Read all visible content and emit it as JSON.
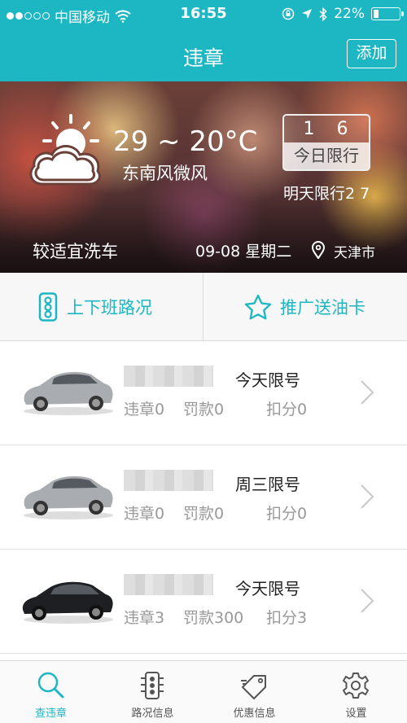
{
  "status_bar": {
    "carrier": "中国移动",
    "time": "16:55",
    "battery": "22%",
    "battery_fraction": 0.22
  },
  "nav": {
    "title": "违章",
    "add_label": "添加"
  },
  "weather": {
    "temp": "29 ~ 20°C",
    "wind": "东南风微风",
    "today_limit_number": "1 6",
    "today_limit_label": "今日限行",
    "tomorrow_limit": "明天限行2 7",
    "wash_advice": "较适宜洗车",
    "date": "09-08 星期二",
    "city": "天津市"
  },
  "quick_actions": {
    "commute_label": "上下班路况",
    "promo_label": "推广送油卡"
  },
  "vehicles": [
    {
      "status": "今天限号",
      "violations": "违章0",
      "fine": "罚款0",
      "points": "扣分0",
      "car_color": "silver"
    },
    {
      "status": "周三限号",
      "violations": "违章0",
      "fine": "罚款0",
      "points": "扣分0",
      "car_color": "silver"
    },
    {
      "status": "今天限号",
      "violations": "违章3",
      "fine": "罚款300",
      "points": "扣分3",
      "car_color": "black"
    }
  ],
  "tabs": [
    {
      "label": "查违章",
      "icon": "search-icon",
      "active": true
    },
    {
      "label": "路况信息",
      "icon": "traffic-light-icon",
      "active": false
    },
    {
      "label": "优惠信息",
      "icon": "tag-icon",
      "active": false
    },
    {
      "label": "设置",
      "icon": "gear-icon",
      "active": false
    }
  ],
  "colors": {
    "accent": "#1db7c4",
    "muted_text": "#999999"
  }
}
